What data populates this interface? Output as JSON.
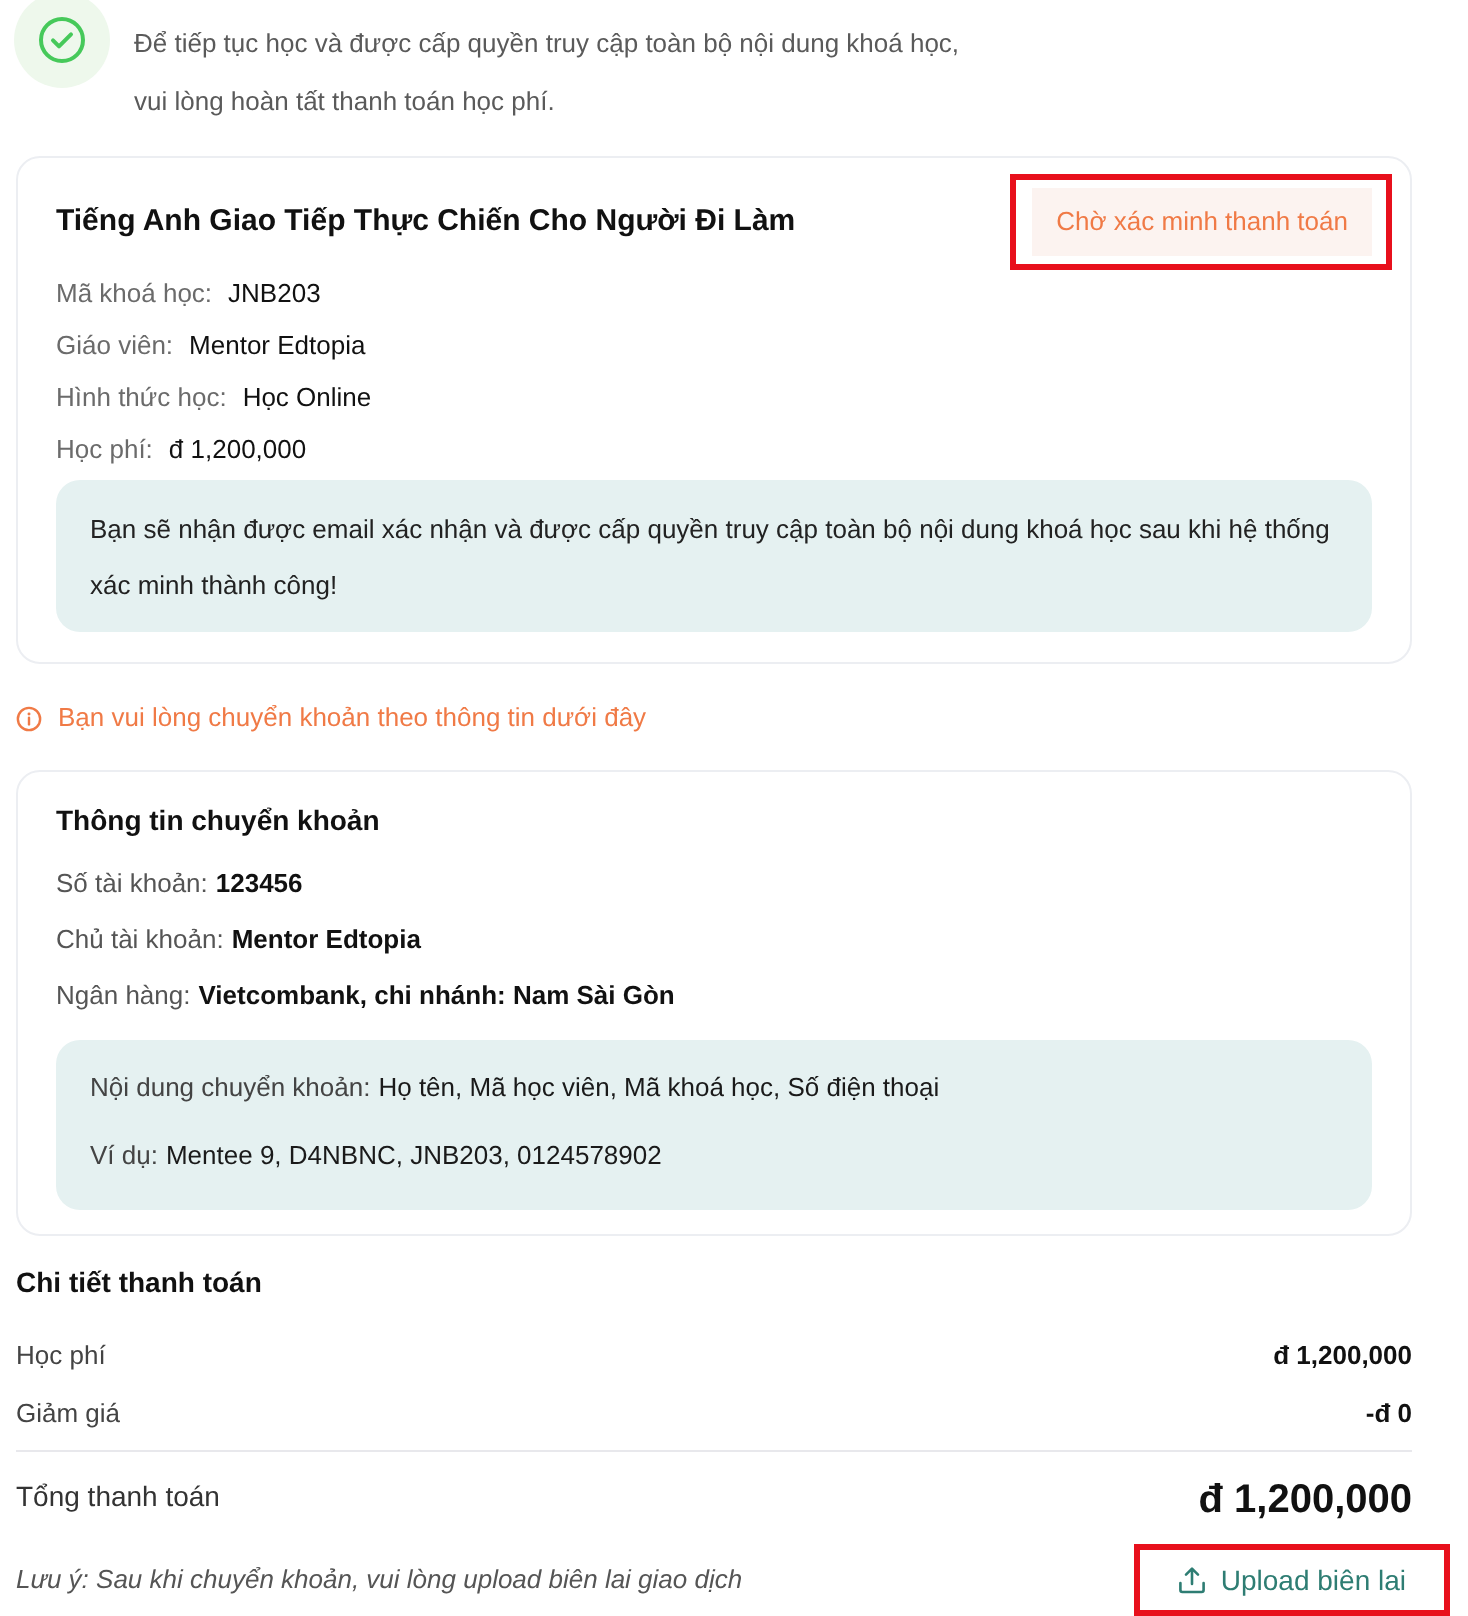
{
  "header": {
    "message_lines": [
      "Để tiếp tục học và được cấp quyền truy cập toàn bộ nội dung khoá học,",
      "vui lòng hoàn tất thanh toán học phí."
    ]
  },
  "course": {
    "title": "Tiếng Anh Giao Tiếp Thực Chiến Cho Người Đi Làm",
    "status": {
      "label": "Chờ xác minh thanh toán",
      "highlighted": true
    },
    "fields": [
      {
        "label": "Mã khoá học:",
        "value": "JNB203"
      },
      {
        "label": "Giáo viên:",
        "value": "Mentor Edtopia"
      },
      {
        "label": "Hình thức học:",
        "value": "Học Online"
      },
      {
        "label": "Học phí:",
        "value": "đ 1,200,000"
      }
    ],
    "note": "Bạn sẽ nhận được email xác nhận và được cấp quyền truy cập toàn bộ nội dung khoá học sau khi hệ thống xác minh thành công!"
  },
  "notice": {
    "text": "Bạn vui lòng chuyển khoản theo thông tin dưới đây"
  },
  "transfer": {
    "title": "Thông tin chuyển khoản",
    "fields": [
      {
        "label": "Số tài khoản:",
        "value": "123456"
      },
      {
        "label": "Chủ tài khoản:",
        "value": "Mentor Edtopia"
      },
      {
        "label": "Ngân hàng:",
        "value": "Vietcombank, chi nhánh: Nam Sài Gòn"
      }
    ],
    "instructions": [
      {
        "label": "Nội dung chuyển khoản:",
        "value": "Họ tên, Mã học viên, Mã khoá học, Số điện thoại"
      },
      {
        "label": "Ví dụ:",
        "value": "Mentee 9, D4NBNC, JNB203, 0124578902"
      }
    ]
  },
  "payment": {
    "title": "Chi tiết thanh toán",
    "lines": [
      {
        "label": "Học phí",
        "amount": "đ 1,200,000"
      },
      {
        "label": "Giảm giá",
        "amount": "-đ 0"
      }
    ],
    "total": {
      "label": "Tổng thanh toán",
      "amount": "đ 1,200,000"
    },
    "note": "Lưu ý: Sau khi chuyển khoản, vui lòng upload biên lai giao dịch",
    "upload_button": {
      "label": "Upload biên lai",
      "highlighted": true
    }
  }
}
